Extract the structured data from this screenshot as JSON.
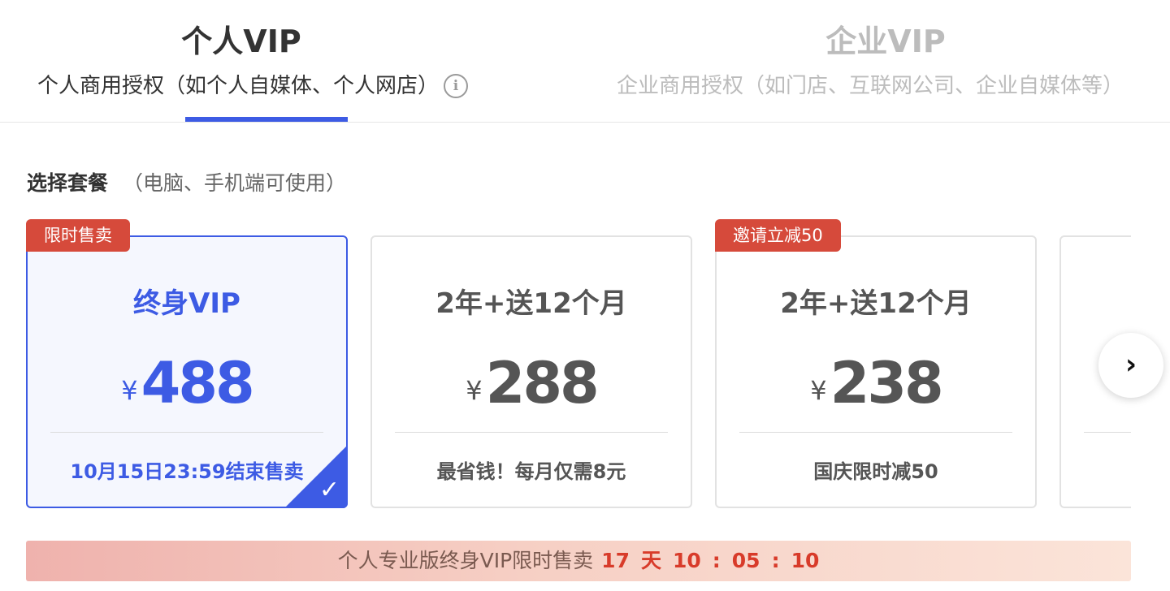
{
  "tabs": [
    {
      "title": "个人VIP",
      "subtitle": "个人商用授权（如个人自媒体、个人网店）",
      "active": true
    },
    {
      "title": "企业VIP",
      "subtitle": "企业商用授权（如门店、互联网公司、企业自媒体等）",
      "active": false
    }
  ],
  "section": {
    "title": "选择套餐",
    "note": "（电脑、手机端可使用）"
  },
  "plans": [
    {
      "badge": "限时售卖",
      "name": "终身VIP",
      "currency": "¥",
      "price": "488",
      "desc": "10月15日23:59结束售卖",
      "selected": true
    },
    {
      "badge": "",
      "name": "2年+送12个月",
      "currency": "¥",
      "price": "288",
      "desc": "最省钱！每月仅需8元",
      "selected": false
    },
    {
      "badge": "邀请立减50",
      "name": "2年+送12个月",
      "currency": "¥",
      "price": "238",
      "desc": "国庆限时减50",
      "selected": false
    },
    {
      "badge": "",
      "name": "",
      "currency": "",
      "price": "",
      "desc": "",
      "selected": false
    }
  ],
  "promo": {
    "text": "个人专业版终身VIP限时售卖",
    "days": "17",
    "days_unit": "天",
    "hours": "10",
    "minutes": "05",
    "seconds": "10",
    "separator": ":"
  },
  "colors": {
    "accent": "#3d5be4",
    "badge": "#d64a3b",
    "countdown": "#d83b2a"
  },
  "icons": {
    "info": "info-icon",
    "check": "check-icon",
    "next": "chevron-right-icon"
  }
}
